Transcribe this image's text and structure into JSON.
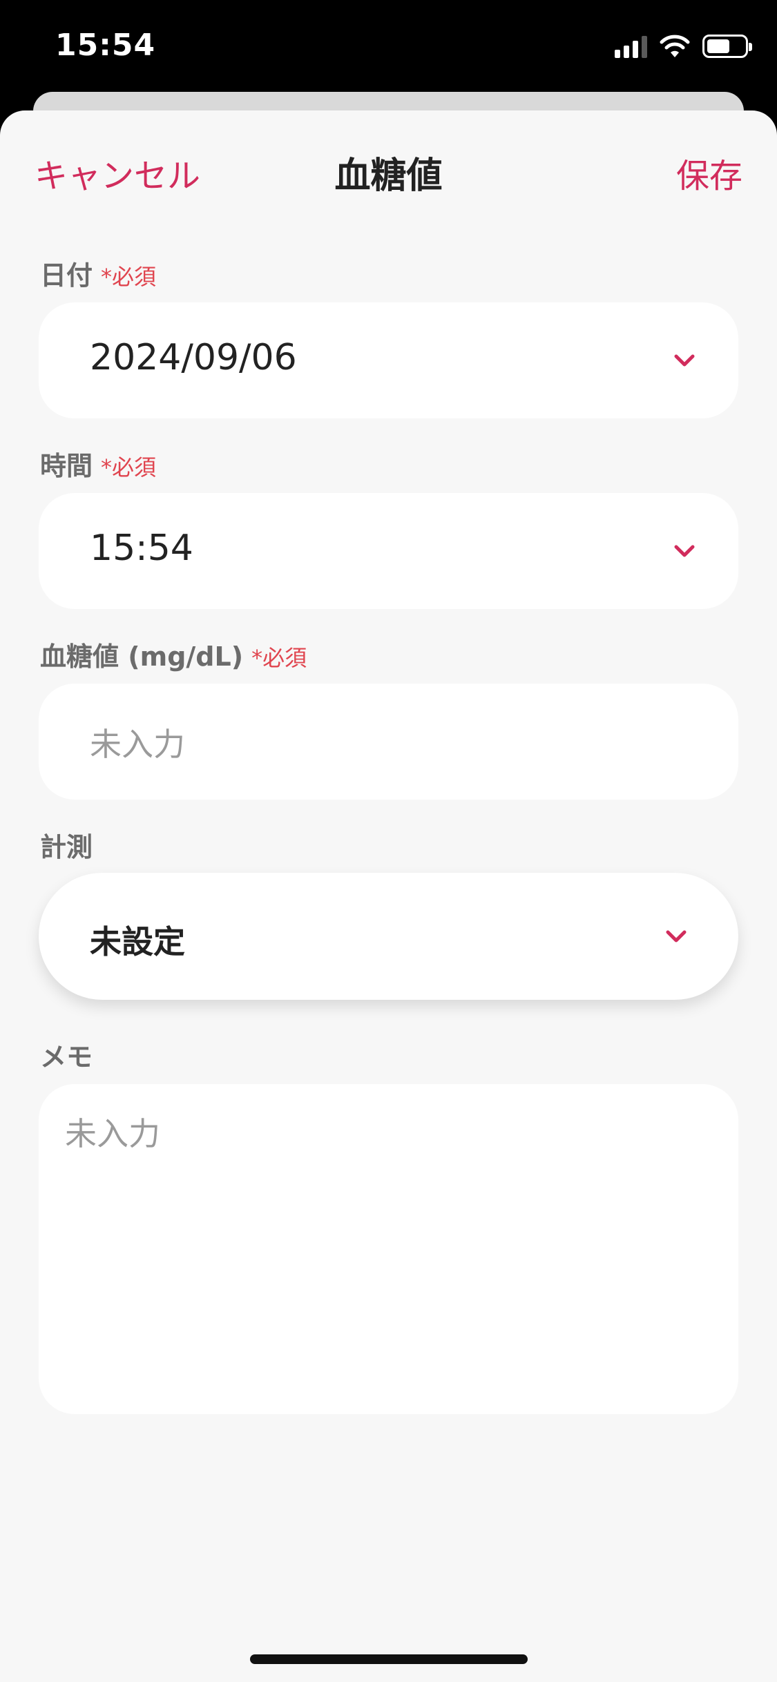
{
  "status_bar": {
    "time": "15:54"
  },
  "nav": {
    "cancel_label": "キャンセル",
    "title": "血糖値",
    "save_label": "保存"
  },
  "form": {
    "required_mark": "*必須",
    "date": {
      "label": "日付",
      "value": "2024/09/06"
    },
    "time": {
      "label": "時間",
      "value": "15:54"
    },
    "glucose": {
      "label": "血糖値 (mg/dL)",
      "placeholder": "未入力"
    },
    "measurement": {
      "label": "計測",
      "value": "未設定"
    },
    "memo": {
      "label": "メモ",
      "placeholder": "未入力"
    }
  },
  "icons": {
    "chevron": "chevron-down-icon",
    "wifi": "wifi-icon",
    "signal": "cellular-signal-icon",
    "battery": "battery-icon"
  },
  "colors": {
    "accent": "#d12c5c",
    "required": "#e0454f",
    "sheet_background": "#f7f7f7",
    "field_background": "#ffffff"
  }
}
